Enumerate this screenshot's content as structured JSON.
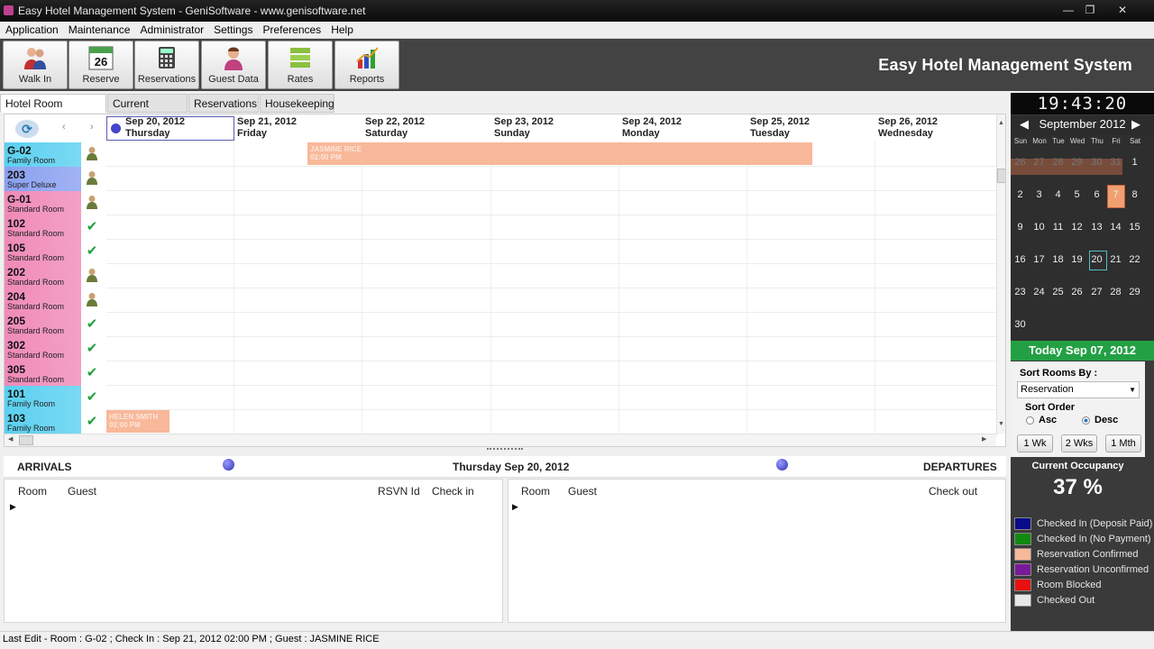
{
  "window": {
    "title": "Easy Hotel Management System - GeniSoftware - www.genisoftware.net"
  },
  "menu": [
    "Application",
    "Maintenance",
    "Administrator",
    "Settings",
    "Preferences",
    "Help"
  ],
  "toolbar": {
    "buttons": [
      {
        "label": "Walk In",
        "icon": "people-icon"
      },
      {
        "label": "Reserve",
        "icon": "calendar-icon",
        "badge": "26"
      },
      {
        "label": "Reservations",
        "icon": "calculator-icon"
      },
      {
        "label": "Guest Data",
        "icon": "guest-icon"
      },
      {
        "label": "Rates",
        "icon": "stack-icon"
      },
      {
        "label": "Reports",
        "icon": "chart-icon"
      }
    ],
    "banner": "Easy Hotel Management System"
  },
  "tabs": [
    "Hotel Room Planner",
    "Current Guests",
    "Reservations",
    "Housekeeping"
  ],
  "planner": {
    "days": [
      {
        "date": "Sep 20, 2012",
        "weekday": "Thursday"
      },
      {
        "date": "Sep 21, 2012",
        "weekday": "Friday"
      },
      {
        "date": "Sep 22, 2012",
        "weekday": "Saturday"
      },
      {
        "date": "Sep 23, 2012",
        "weekday": "Sunday"
      },
      {
        "date": "Sep 24, 2012",
        "weekday": "Monday"
      },
      {
        "date": "Sep 25, 2012",
        "weekday": "Tuesday"
      },
      {
        "date": "Sep 26, 2012",
        "weekday": "Wednesday"
      }
    ],
    "rooms": [
      {
        "number": "G-02",
        "type": "Family Room",
        "color": "#5ad0f0",
        "status": "occupied"
      },
      {
        "number": "203",
        "type": "Super Deluxe",
        "color": "#8aa0f0",
        "status": "occupied"
      },
      {
        "number": "G-01",
        "type": "Standard Room",
        "color": "#f08ab8",
        "status": "occupied"
      },
      {
        "number": "102",
        "type": "Standard Room",
        "color": "#f08ab8",
        "status": "clean"
      },
      {
        "number": "105",
        "type": "Standard Room",
        "color": "#f08ab8",
        "status": "clean"
      },
      {
        "number": "202",
        "type": "Standard Room",
        "color": "#f08ab8",
        "status": "occupied"
      },
      {
        "number": "204",
        "type": "Standard Room",
        "color": "#f08ab8",
        "status": "occupied"
      },
      {
        "number": "205",
        "type": "Standard Room",
        "color": "#f08ab8",
        "status": "clean"
      },
      {
        "number": "302",
        "type": "Standard Room",
        "color": "#f08ab8",
        "status": "clean"
      },
      {
        "number": "305",
        "type": "Standard Room",
        "color": "#f08ab8",
        "status": "clean"
      },
      {
        "number": "101",
        "type": "Family Room",
        "color": "#5ad0f0",
        "status": "clean"
      },
      {
        "number": "103",
        "type": "Family Room",
        "color": "#5ad0f0",
        "status": "clean"
      }
    ],
    "bookings": [
      {
        "guest": "JASMINE RICE",
        "time": "02:00 PM"
      },
      {
        "guest": "HELEN SMITH",
        "time": "02:00 PM"
      }
    ]
  },
  "arrivals": {
    "title": "ARRIVALS",
    "columns": [
      "Room",
      "Guest",
      "RSVN Id",
      "Check in"
    ]
  },
  "departures": {
    "title": "DEPARTURES",
    "columns": [
      "Room",
      "Guest",
      "Check out"
    ]
  },
  "selected_date_label": "Thursday Sep 20, 2012",
  "status_bar": "Last Edit -  Room : G-02 ; Check In : Sep 21, 2012 02:00 PM ; Guest : JASMINE RICE",
  "sidebar": {
    "clock": "19:43:20",
    "calendar": {
      "month": "September 2012",
      "weekdays": [
        "Sun",
        "Mon",
        "Tue",
        "Wed",
        "Thu",
        "Fri",
        "Sat"
      ],
      "weeks": [
        [
          "26",
          "27",
          "28",
          "29",
          "30",
          "31",
          "1"
        ],
        [
          "2",
          "3",
          "4",
          "5",
          "6",
          "7",
          "8"
        ],
        [
          "9",
          "10",
          "11",
          "12",
          "13",
          "14",
          "15"
        ],
        [
          "16",
          "17",
          "18",
          "19",
          "20",
          "21",
          "22"
        ],
        [
          "23",
          "24",
          "25",
          "26",
          "27",
          "28",
          "29"
        ],
        [
          "30",
          "",
          "",
          "",
          "",
          "",
          ""
        ]
      ]
    },
    "today": "Today Sep 07, 2012",
    "sort_by_label": "Sort Rooms By :",
    "sort_by_value": "Reservation",
    "sort_order_label": "Sort Order",
    "asc": "Asc",
    "desc": "Desc",
    "range_buttons": [
      "1 Wk",
      "2 Wks",
      "1 Mth"
    ],
    "occupancy_title": "Current Occupancy",
    "occupancy_value": "37 %",
    "legend": [
      {
        "label": "Checked In (Deposit Paid)",
        "color": "#0a0a8a"
      },
      {
        "label": "Checked In (No Payment)",
        "color": "#128a12"
      },
      {
        "label": "Reservation Confirmed",
        "color": "#f8b89a"
      },
      {
        "label": "Reservation Unconfirmed",
        "color": "#7a1a9a"
      },
      {
        "label": "Room Blocked",
        "color": "#e81010"
      },
      {
        "label": "Checked Out",
        "color": "#e8e8e8"
      }
    ]
  }
}
